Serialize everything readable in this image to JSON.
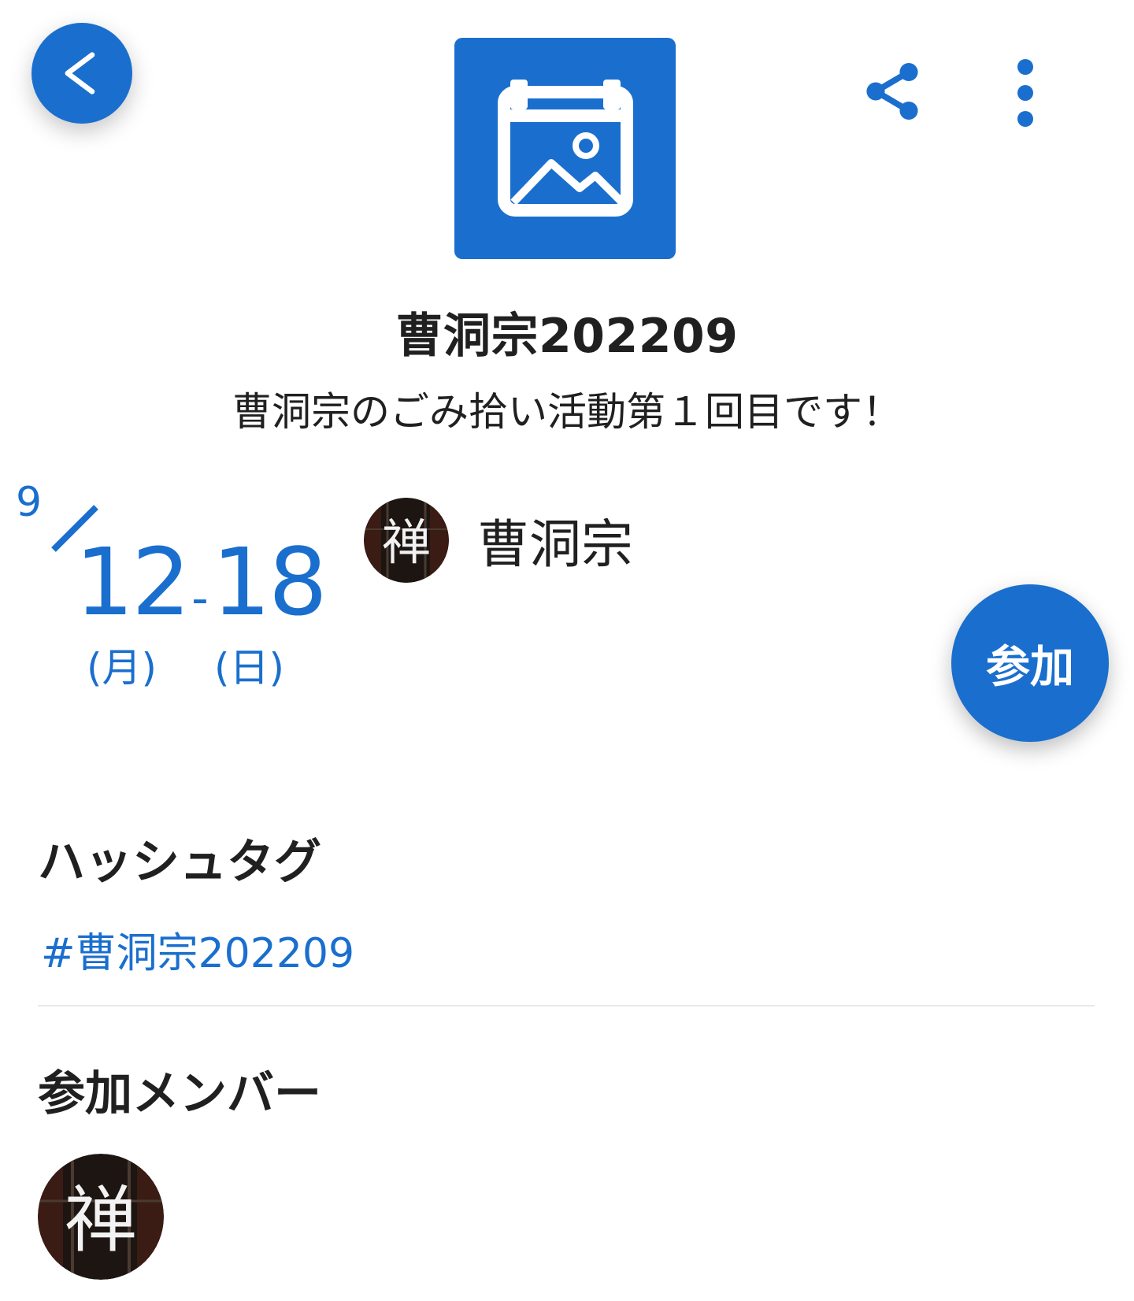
{
  "header": {
    "back_icon": "chevron-left-icon",
    "share_icon": "share-icon",
    "more_icon": "more-vertical-icon",
    "event_image_icon": "calendar-image-icon"
  },
  "event": {
    "title": "曹洞宗202209",
    "description": "曹洞宗のごみ拾い活動第１回目です！"
  },
  "date": {
    "month": "9",
    "start_day": "12",
    "separator": "-",
    "end_day": "18",
    "start_weekday": "(月)",
    "end_weekday": "(日)"
  },
  "organizer": {
    "name": "曹洞宗",
    "avatar_glyph": "禅"
  },
  "join_button": {
    "label": "参加"
  },
  "hashtags": {
    "heading": "ハッシュタグ",
    "items": [
      "#曹洞宗202209"
    ]
  },
  "members": {
    "heading": "参加メンバー",
    "avatar_glyph": "禅"
  },
  "colors": {
    "accent": "#1a6fce",
    "text": "#202020",
    "divider": "#e8e8e8"
  }
}
